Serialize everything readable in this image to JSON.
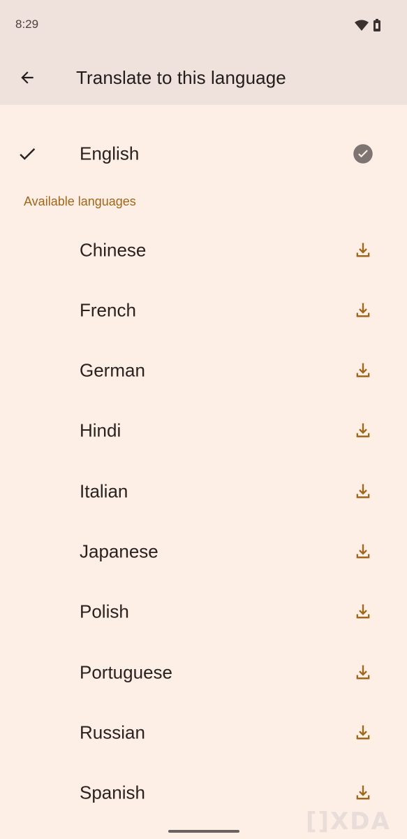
{
  "status_bar": {
    "time": "8:29",
    "icons": [
      "wifi-icon",
      "battery-icon"
    ]
  },
  "app_bar": {
    "title": "Translate to this language",
    "back_icon": "arrow-back-icon"
  },
  "selected_language": {
    "label": "English",
    "leading_icon": "check-icon",
    "trailing_icon": "check-circle-icon"
  },
  "section": {
    "header": "Available languages"
  },
  "available_languages": [
    {
      "label": "Chinese",
      "icon": "download-icon"
    },
    {
      "label": "French",
      "icon": "download-icon"
    },
    {
      "label": "German",
      "icon": "download-icon"
    },
    {
      "label": "Hindi",
      "icon": "download-icon"
    },
    {
      "label": "Italian",
      "icon": "download-icon"
    },
    {
      "label": "Japanese",
      "icon": "download-icon"
    },
    {
      "label": "Polish",
      "icon": "download-icon"
    },
    {
      "label": "Portuguese",
      "icon": "download-icon"
    },
    {
      "label": "Russian",
      "icon": "download-icon"
    },
    {
      "label": "Spanish",
      "icon": "download-icon"
    }
  ],
  "watermark": "[]XDA",
  "colors": {
    "background": "#fdeee6",
    "app_bar": "#efe2dc",
    "accent": "#a0661a",
    "text": "#2a2220",
    "check_circle": "#7e7572"
  }
}
